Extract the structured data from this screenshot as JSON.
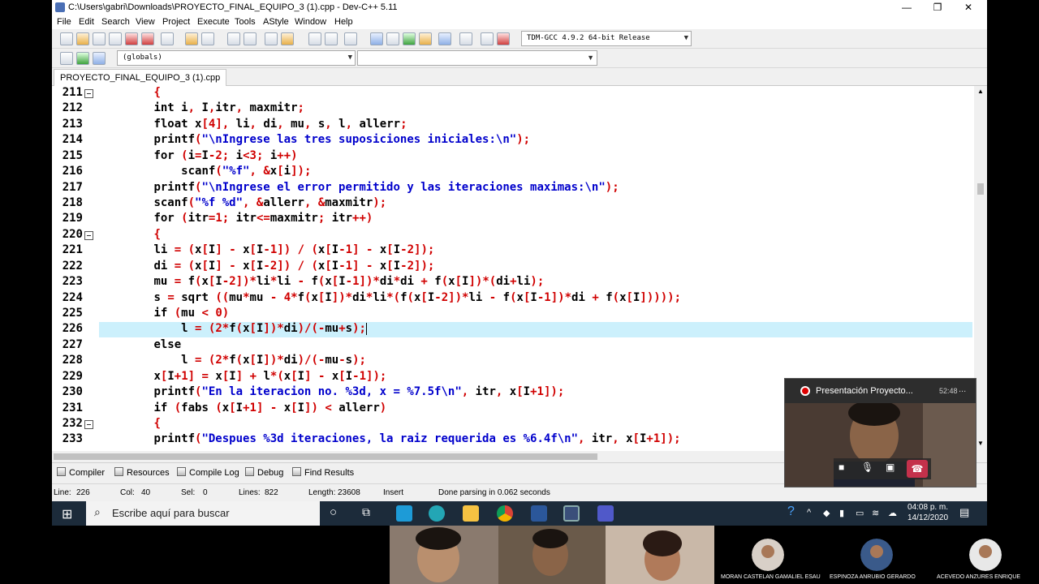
{
  "window": {
    "title": "C:\\Users\\gabri\\Downloads\\PROYECTO_FINAL_EQUIPO_3 (1).cpp - Dev-C++ 5.11",
    "minimize": "—",
    "restore": "❐",
    "close": "✕"
  },
  "menu": [
    "File",
    "Edit",
    "Search",
    "View",
    "Project",
    "Execute",
    "Tools",
    "AStyle",
    "Window",
    "Help"
  ],
  "toolbar": {
    "compiler_combo": "TDM-GCC 4.9.2 64-bit Release",
    "globals_combo": "(globals)",
    "second_combo": ""
  },
  "tab": {
    "label": "PROYECTO_FINAL_EQUIPO_3 (1).cpp"
  },
  "editor": {
    "lines": [
      {
        "num": "211",
        "text": "    {"
      },
      {
        "num": "212",
        "text": "    int i, I,itr, maxmitr;"
      },
      {
        "num": "213",
        "text": "    float x[4], li, di, mu, s, l, allerr;"
      },
      {
        "num": "214",
        "text": "    printf(\"\\nIngrese las tres suposiciones iniciales:\\n\");"
      },
      {
        "num": "215",
        "text": "    for (i=I-2; i<3; i++)"
      },
      {
        "num": "216",
        "text": "        scanf(\"%f\", &x[i]);"
      },
      {
        "num": "217",
        "text": "    printf(\"\\nIngrese el error permitido y las iteraciones maximas:\\n\");"
      },
      {
        "num": "218",
        "text": "    scanf(\"%f %d\", &allerr, &maxmitr);"
      },
      {
        "num": "219",
        "text": "    for (itr=1; itr<=maxmitr; itr++)"
      },
      {
        "num": "220",
        "text": "    {"
      },
      {
        "num": "221",
        "text": "    li = (x[I] - x[I-1]) / (x[I-1] - x[I-2]);"
      },
      {
        "num": "222",
        "text": "    di = (x[I] - x[I-2]) / (x[I-1] - x[I-2]);"
      },
      {
        "num": "223",
        "text": "    mu = f(x[I-2])*li*li - f(x[I-1])*di*di + f(x[I])*(di+li);"
      },
      {
        "num": "224",
        "text": "    s = sqrt ((mu*mu - 4*f(x[I])*di*li*(f(x[I-2])*li - f(x[I-1])*di + f(x[I]))));"
      },
      {
        "num": "225",
        "text": "    if (mu < 0)"
      },
      {
        "num": "226",
        "text": "        l = (2*f(x[I])*di)/(-mu+s);"
      },
      {
        "num": "227",
        "text": "    else"
      },
      {
        "num": "228",
        "text": "        l = (2*f(x[I])*di)/(-mu-s);"
      },
      {
        "num": "229",
        "text": "    x[I+1] = x[I] + l*(x[I] - x[I-1]);"
      },
      {
        "num": "230",
        "text": "    printf(\"En la iteracion no. %3d, x = %7.5f\\n\", itr, x[I+1]);"
      },
      {
        "num": "231",
        "text": "    if (fabs (x[I+1] - x[I]) < allerr)"
      },
      {
        "num": "232",
        "text": "    {"
      },
      {
        "num": "233",
        "text": "    printf(\"Despues %3d iteraciones, la raiz requerida es %6.4f\\n\", itr, x[I+1]);"
      }
    ],
    "fold_lines": [
      "211",
      "220",
      "232"
    ],
    "current_line": "226"
  },
  "bottom_tabs": [
    "Compiler",
    "Resources",
    "Compile Log",
    "Debug",
    "Find Results"
  ],
  "status": {
    "line_label": "Line:",
    "line": "226",
    "col_label": "Col:",
    "col": "40",
    "sel_label": "Sel:",
    "sel": "0",
    "lines_label": "Lines:",
    "lines": "822",
    "length_label": "Length:",
    "length": "23608",
    "mode": "Insert",
    "message": "Done parsing in 0.062 seconds"
  },
  "taskbar": {
    "search_placeholder": "Escribe aquí para buscar",
    "time": "04:08 p. m.",
    "date": "14/12/2020"
  },
  "teams": {
    "title": "Presentación Proyecto...",
    "timer": "52:48",
    "more": "..."
  },
  "participants": [
    "MORAN CASTELAN GAMALIEL ESAU",
    "ESPINOZA ANRUBIO GERARDO",
    "ACEVEDO ANZURES ENRIQUE"
  ],
  "colors": {
    "editor_bg": "#ffffff",
    "current_line_bg": "#ccf0fc",
    "keyword": "#000000",
    "string": "#0000cc",
    "symbol": "#d00000",
    "taskbar": "#1c2b3a"
  }
}
